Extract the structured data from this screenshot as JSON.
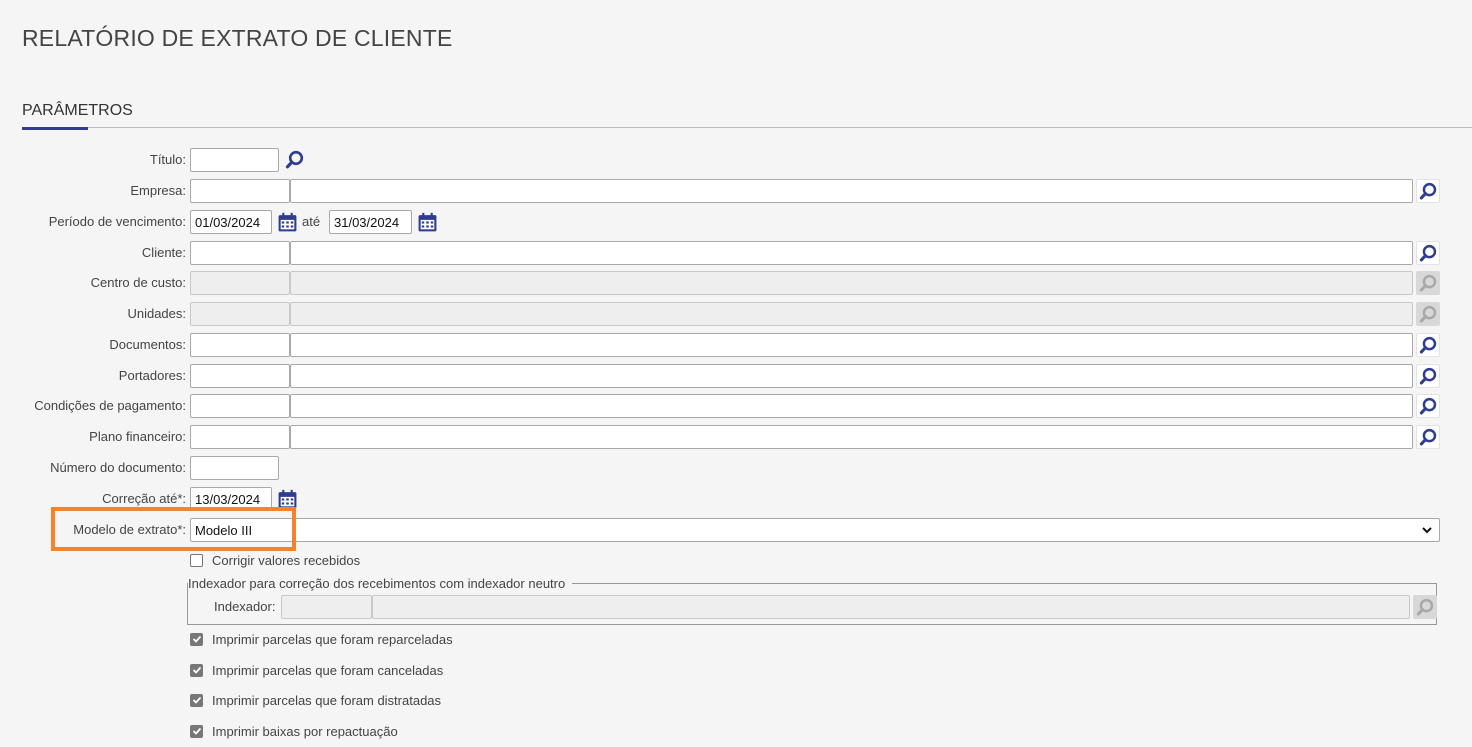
{
  "page": {
    "title": "RELATÓRIO DE EXTRATO DE CLIENTE"
  },
  "section": {
    "title": "PARÂMETROS"
  },
  "fields": {
    "titulo": {
      "label": "Título:",
      "value": ""
    },
    "empresa": {
      "label": "Empresa:",
      "code": "",
      "name": ""
    },
    "periodo": {
      "label": "Período de vencimento:",
      "start": "01/03/2024",
      "sep": "até",
      "end": "31/03/2024"
    },
    "cliente": {
      "label": "Cliente:",
      "code": "",
      "name": ""
    },
    "centro_custo": {
      "label": "Centro de custo:",
      "code": "",
      "name": ""
    },
    "unidades": {
      "label": "Unidades:",
      "code": "",
      "name": ""
    },
    "documentos": {
      "label": "Documentos:",
      "code": "",
      "name": ""
    },
    "portadores": {
      "label": "Portadores:",
      "code": "",
      "name": ""
    },
    "condicoes": {
      "label": "Condições de pagamento:",
      "code": "",
      "name": ""
    },
    "plano": {
      "label": "Plano financeiro:",
      "code": "",
      "name": ""
    },
    "numero_documento": {
      "label": "Número do documento:",
      "value": ""
    },
    "correcao": {
      "label": "Correção até*:",
      "value": "13/03/2024"
    },
    "modelo": {
      "label": "Modelo de extrato*:",
      "selected": "Modelo III"
    }
  },
  "checkboxes": {
    "corrigir": {
      "label": "Corrigir valores recebidos",
      "checked": false
    },
    "reparceladas": {
      "label": "Imprimir parcelas que foram reparceladas",
      "checked": true
    },
    "canceladas": {
      "label": "Imprimir parcelas que foram canceladas",
      "checked": true
    },
    "distratadas": {
      "label": "Imprimir parcelas que foram distratadas",
      "checked": true
    },
    "repactuacao": {
      "label": "Imprimir baixas por repactuação",
      "checked": true
    }
  },
  "indexador_group": {
    "legend": "Indexador para correção dos recebimentos com indexador neutro",
    "label": "Indexador:",
    "code": "",
    "name": ""
  },
  "icons": {
    "search": "search-icon",
    "calendar": "calendar-icon",
    "dropdown": "chevron-down-icon",
    "check": "check-icon"
  },
  "colors": {
    "accent": "#2f3c8f",
    "highlight": "#f5832a",
    "disabled_icon": "#a8a8a8"
  }
}
